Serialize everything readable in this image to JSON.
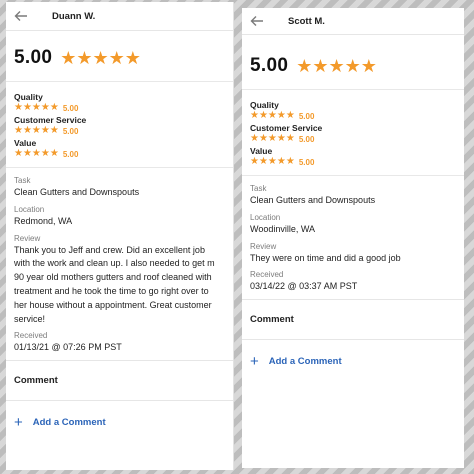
{
  "colors": {
    "star": "#f39a2b",
    "link": "#2b64b8"
  },
  "left": {
    "reviewer": "Duann W.",
    "overall_score": "5.00",
    "overall_stars": "★★★★★",
    "ratings": [
      {
        "label": "Quality",
        "stars": "★★★★★",
        "value": "5.00"
      },
      {
        "label": "Customer Service",
        "stars": "★★★★★",
        "value": "5.00"
      },
      {
        "label": "Value",
        "stars": "★★★★★",
        "value": "5.00"
      }
    ],
    "task_label": "Task",
    "task": "Clean Gutters and Downspouts",
    "location_label": "Location",
    "location": "Redmond, WA",
    "review_label": "Review",
    "review_lines": [
      "Thank you to Jeff and crew. Did an excellent job",
      "with the work and clean up. I also needed to get m",
      "90 year old mothers gutters and roof cleaned with",
      "treatment and he took the time to go right over to",
      "her house without a appointment. Great customer",
      "service!"
    ],
    "received_label": "Received",
    "received": "01/13/21 @ 07:26 PM PST",
    "comment_label": "Comment",
    "add_comment": "Add a Comment"
  },
  "right": {
    "reviewer": "Scott M.",
    "overall_score": "5.00",
    "overall_stars": "★★★★★",
    "ratings": [
      {
        "label": "Quality",
        "stars": "★★★★★",
        "value": "5.00"
      },
      {
        "label": "Customer Service",
        "stars": "★★★★★",
        "value": "5.00"
      },
      {
        "label": "Value",
        "stars": "★★★★★",
        "value": "5.00"
      }
    ],
    "task_label": "Task",
    "task": "Clean Gutters and Downspouts",
    "location_label": "Location",
    "location": "Woodinville, WA",
    "review_label": "Review",
    "review_lines": [
      "They were on time and did a good job"
    ],
    "received_label": "Received",
    "received": "03/14/22 @ 03:37 AM PST",
    "comment_label": "Comment",
    "add_comment": "Add a Comment"
  }
}
